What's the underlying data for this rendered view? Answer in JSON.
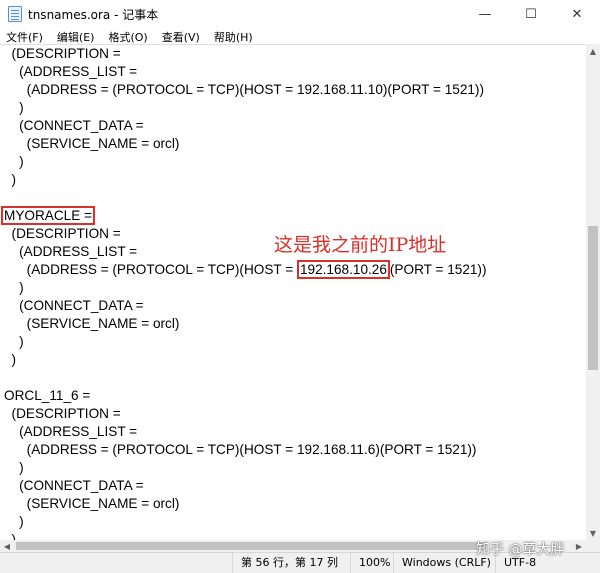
{
  "window": {
    "title": "tnsnames.ora - 记事本",
    "minimize_glyph": "—",
    "maximize_glyph": "☐",
    "close_glyph": "✕"
  },
  "menu": [
    "文件(F)",
    "编辑(E)",
    "格式(O)",
    "查看(V)",
    "帮助(H)"
  ],
  "editor": {
    "lines": [
      "  (DESCRIPTION =",
      "    (ADDRESS_LIST =",
      "      (ADDRESS = (PROTOCOL = TCP)(HOST = 192.168.11.10)(PORT = 1521))",
      "    )",
      "    (CONNECT_DATA =",
      "      (SERVICE_NAME = orcl)",
      "    )",
      "  )",
      "",
      "MYORACLE =",
      "  (DESCRIPTION =",
      "    (ADDRESS_LIST =",
      "      (ADDRESS = (PROTOCOL = TCP)(HOST = 192.168.10.26)(PORT = 1521))",
      "    )",
      "    (CONNECT_DATA =",
      "      (SERVICE_NAME = orcl)",
      "    )",
      "  )",
      "",
      "ORCL_11_6 =",
      "  (DESCRIPTION =",
      "    (ADDRESS_LIST =",
      "      (ADDRESS = (PROTOCOL = TCP)(HOST = 192.168.11.6)(PORT = 1521))",
      "    )",
      "    (CONNECT_DATA =",
      "      (SERVICE_NAME = orcl)",
      "    )",
      "  )"
    ],
    "highlight_name": "MYORACLE =",
    "highlight_ip": "192.168.10.26",
    "annotation": "这是我之前的IP地址",
    "highlight_color": "#d9302a"
  },
  "status": {
    "position": "第 56 行，第 17 列",
    "zoom": "100%",
    "line_ending": "Windows (CRLF)",
    "encoding": "UTF-8"
  },
  "watermark": "知乎 @草大胖"
}
